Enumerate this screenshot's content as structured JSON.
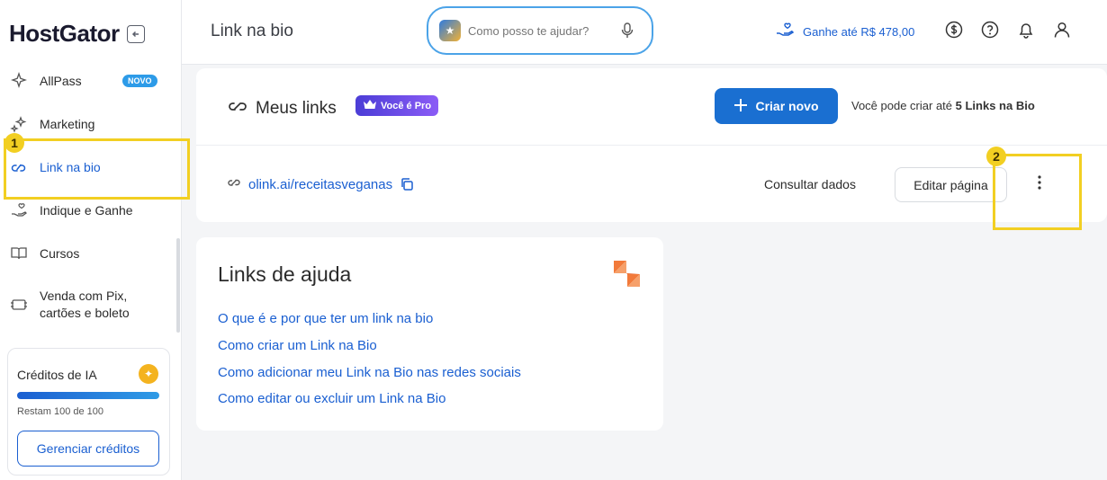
{
  "sidebar": {
    "logo": "HostGator",
    "items": [
      {
        "label": "AllPass",
        "badge": "NOVO",
        "icon": "sparkle-icon"
      },
      {
        "label": "Marketing",
        "icon": "sparkle-icon"
      },
      {
        "label": "Link na bio",
        "icon": "link-icon"
      },
      {
        "label": "Indique e Ganhe",
        "icon": "hand-heart-icon"
      },
      {
        "label": "Cursos",
        "icon": "book-icon"
      },
      {
        "label": "Venda com Pix,",
        "label2": "cartões e boleto",
        "icon": "payment-icon"
      }
    ],
    "credits": {
      "title": "Créditos de IA",
      "remaining": "Restam 100 de 100",
      "progress": 1.0,
      "button": "Gerenciar créditos"
    }
  },
  "header": {
    "title": "Link na bio",
    "search_placeholder": "Como posso te ajudar?",
    "earn_label": "Ganhe até R$ 478,00"
  },
  "links": {
    "title": "Meus links",
    "pro_badge": "Você é Pro",
    "create_button": "Criar novo",
    "limit_prefix": "Você pode criar até ",
    "limit_value": "5 Links na Bio",
    "row": {
      "url": "olink.ai/receitasveganas",
      "consult": "Consultar dados",
      "edit": "Editar página"
    }
  },
  "help": {
    "title": "Links de ajuda",
    "items": [
      "O que é e por que ter um link na bio",
      "Como criar um Link na Bio",
      "Como adicionar meu Link na Bio nas redes sociais",
      "Como editar ou excluir um Link na Bio"
    ]
  },
  "annotations": {
    "marker1": "1",
    "marker2": "2"
  },
  "colors": {
    "accent": "#1a5fd1",
    "highlight": "#f2cf22",
    "pro_gradient": "#6a4ce0"
  }
}
